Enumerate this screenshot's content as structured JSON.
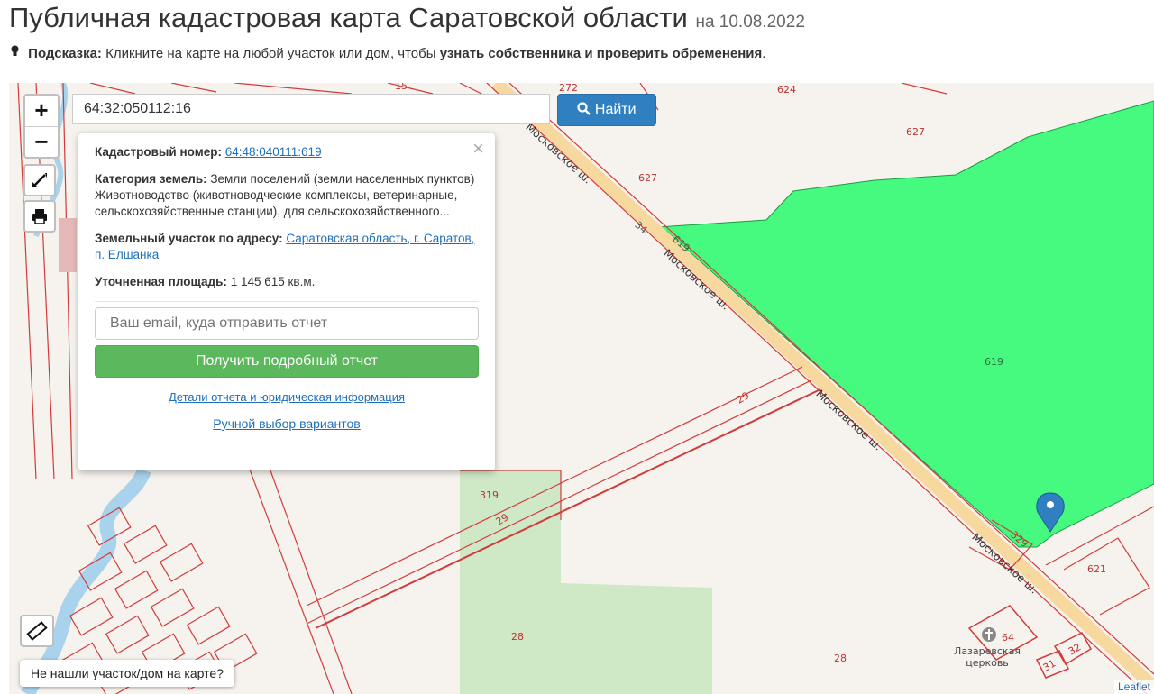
{
  "header": {
    "title": "Публичная кадастровая карта Саратовской области",
    "date": "на 10.08.2022"
  },
  "hint": {
    "label": "Подсказка:",
    "text": "Кликните на карте на любой участок или дом, чтобы",
    "bold_text": "узнать собственника и проверить обременения",
    "end": "."
  },
  "map_controls": {
    "zoom_in": "+",
    "zoom_out": "−",
    "fullscreen_icon": "expand-icon",
    "print_icon": "printer-icon",
    "ruler_icon": "ruler-icon"
  },
  "search": {
    "value": "64:32:050112:16",
    "button_label": "Найти",
    "button_icon": "search-icon"
  },
  "popup": {
    "cadastral_label": "Кадастровый номер:",
    "cadastral_value": "64:48:040111:619",
    "category_label": "Категория земель:",
    "category_value": "Земли поселений (земли населенных пунктов)",
    "usage": "Животноводство (животноводческие комплексы, ветеринарные, сельскохозяйственные станции), для сельскохозяйственного...",
    "address_label": "Земельный участок по адресу:",
    "address_value": "Саратовская область, г. Саратов, п. Елшанка",
    "area_label": "Уточненная площадь:",
    "area_value": "1 145 615 кв.м.",
    "email_placeholder": "Ваш email, куда отправить отчет",
    "report_button": "Получить подробный отчет",
    "details_link": "Детали отчета и юридическая информация",
    "manual_link": "Ручной выбор вариантов",
    "close": "×"
  },
  "map_labels": {
    "n15": "15",
    "n272": "272",
    "n624": "624",
    "n627a": "627",
    "n627b": "627",
    "n34": "34",
    "n619a": "619",
    "n619b": "619",
    "n29a": "29",
    "n29b": "29",
    "n319": "319",
    "n329": "329",
    "n621": "621",
    "n64": "64",
    "n28a": "28",
    "n28b": "28",
    "n32": "32",
    "n31": "31",
    "church": "Лазаревская церковь",
    "road1": "Московское ш.",
    "road2": "Московское ш.",
    "road3": "Московское ш.",
    "road4": "Московское ш."
  },
  "not_found_button": "Не нашли участок/дом на карте?",
  "attribution": "Leaflet",
  "colors": {
    "parcel_green": "#45fa7e",
    "parcel_border": "#d23b3b",
    "road": "#f7d9a0",
    "button_blue": "#2f7fc1",
    "button_green": "#5cb85c",
    "river": "#a9d2ec",
    "forest": "#cfe8c6"
  }
}
